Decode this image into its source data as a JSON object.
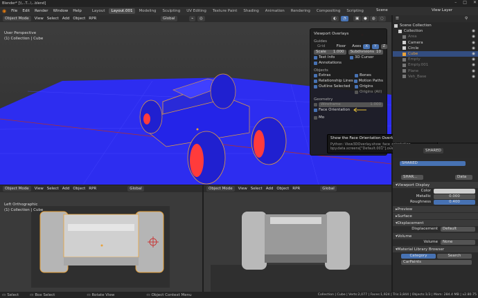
{
  "window": {
    "title": "Blender* [\\\\...T...\\...blend]"
  },
  "menu": {
    "items": [
      "File",
      "Edit",
      "Render",
      "Window",
      "Help"
    ]
  },
  "workspaces": {
    "tabs": [
      "Layout",
      "Layout.001",
      "Modeling",
      "Sculpting",
      "UV Editing",
      "Texture Paint",
      "Shading",
      "Animation",
      "Rendering",
      "Compositing",
      "Scripting"
    ],
    "active_index": 1
  },
  "scene": {
    "label": "Scene",
    "view_layer": "View Layer"
  },
  "viewport_main": {
    "mode": "Object Mode",
    "menus": [
      "View",
      "Select",
      "Add",
      "Object",
      "RPR"
    ],
    "transform": "Global",
    "overlay_title": "User Perspective",
    "overlay_sub": "(1) Collection | Cube"
  },
  "overlays_popup": {
    "title": "Viewport Overlays",
    "guides_header": "Guides",
    "grid": "Grid",
    "floor": "Floor",
    "axes": "Axes",
    "axis_x": "X",
    "axis_y": "Y",
    "axis_z": "Z",
    "scale_label": "Scale",
    "scale_value": "1.000",
    "subdivisions_label": "Subdivisions",
    "subdivisions_value": "10",
    "text_info": "Text Info",
    "cursor_3d": "3D Cursor",
    "annotations": "Annotations",
    "objects_header": "Objects",
    "extras": "Extras",
    "bones": "Bones",
    "relationship_lines": "Relationship Lines",
    "motion_paths": "Motion Paths",
    "outline_selected": "Outline Selected",
    "origins": "Origins",
    "origins_all": "Origins (All)",
    "geometry_header": "Geometry",
    "wireframe": "Wireframe",
    "wireframe_value": "1.000",
    "face_orientation": "Face Orientation",
    "more": "Mo"
  },
  "tooltip": {
    "line1": "Show the Face Orientation Overlay.",
    "line2": "Python: View3DOverlay.show_face_orientation",
    "line3": "bpy.data.screens[\"Default.001\"].overlay.show_face_orientation"
  },
  "outliner": {
    "title": "Scene Collection",
    "items": [
      {
        "name": "Collection",
        "color": "#d0d0d0",
        "indent": 1
      },
      {
        "name": "Area",
        "color": "#777777",
        "indent": 2
      },
      {
        "name": "Camera",
        "color": "#d0d0d0",
        "indent": 2
      },
      {
        "name": "Circle",
        "color": "#d0d0d0",
        "indent": 2
      },
      {
        "name": "Cube",
        "color": "#e8a23a",
        "indent": 2
      },
      {
        "name": "Empty",
        "color": "#777777",
        "indent": 2
      },
      {
        "name": "Empty.001",
        "color": "#777777",
        "indent": 2
      },
      {
        "name": "Plane",
        "color": "#777777",
        "indent": 2
      },
      {
        "name": "Veh_Base",
        "color": "#777777",
        "indent": 2
      }
    ]
  },
  "viewport_left": {
    "mode": "Object Mode",
    "menus": [
      "View",
      "Select",
      "Add",
      "Object",
      "RPR"
    ],
    "transform": "Global",
    "overlay_title": "Left Orthographic",
    "overlay_sub": "(1) Collection | Cube"
  },
  "viewport_right": {
    "mode": "Object Mode",
    "menus": [
      "View",
      "Select",
      "Add",
      "Object",
      "RPR"
    ],
    "transform": "Global"
  },
  "properties": {
    "material_name": "SHARED",
    "slot_name": "SHARED",
    "shared_field": "SHAR...",
    "data_label": "Data",
    "viewport_display": "Viewport Display",
    "color_label": "Color",
    "metallic_label": "Metallic",
    "metallic_value": "0.000",
    "roughness_label": "Roughness",
    "roughness_value": "0.400",
    "preview": "Preview",
    "surface": "Surface",
    "displacement_header": "Displacement",
    "displacement_label": "Displacement",
    "displacement_value": "Default",
    "volume_header": "Volume",
    "volume_label": "Volume",
    "volume_value": "None",
    "material_library": "Material Library Browser",
    "category_tab": "Category",
    "search_tab": "Search",
    "carpaints": "CarPaints"
  },
  "statusbar": {
    "select": "Select",
    "box_select": "Box Select",
    "rotate_view": "Rotate View",
    "context_menu": "Object Context Menu",
    "stats": "Collection | Cube | Verts:2,077 | Faces:1,924 | Tris:3,844 | Objects:1/3 | Mem: 284.4 MB | v2.80.75"
  },
  "colors": {
    "accent": "#4772b3",
    "front_face": "#2222ee",
    "back_face": "#ff3b3b",
    "selected": "#e8a23a"
  }
}
